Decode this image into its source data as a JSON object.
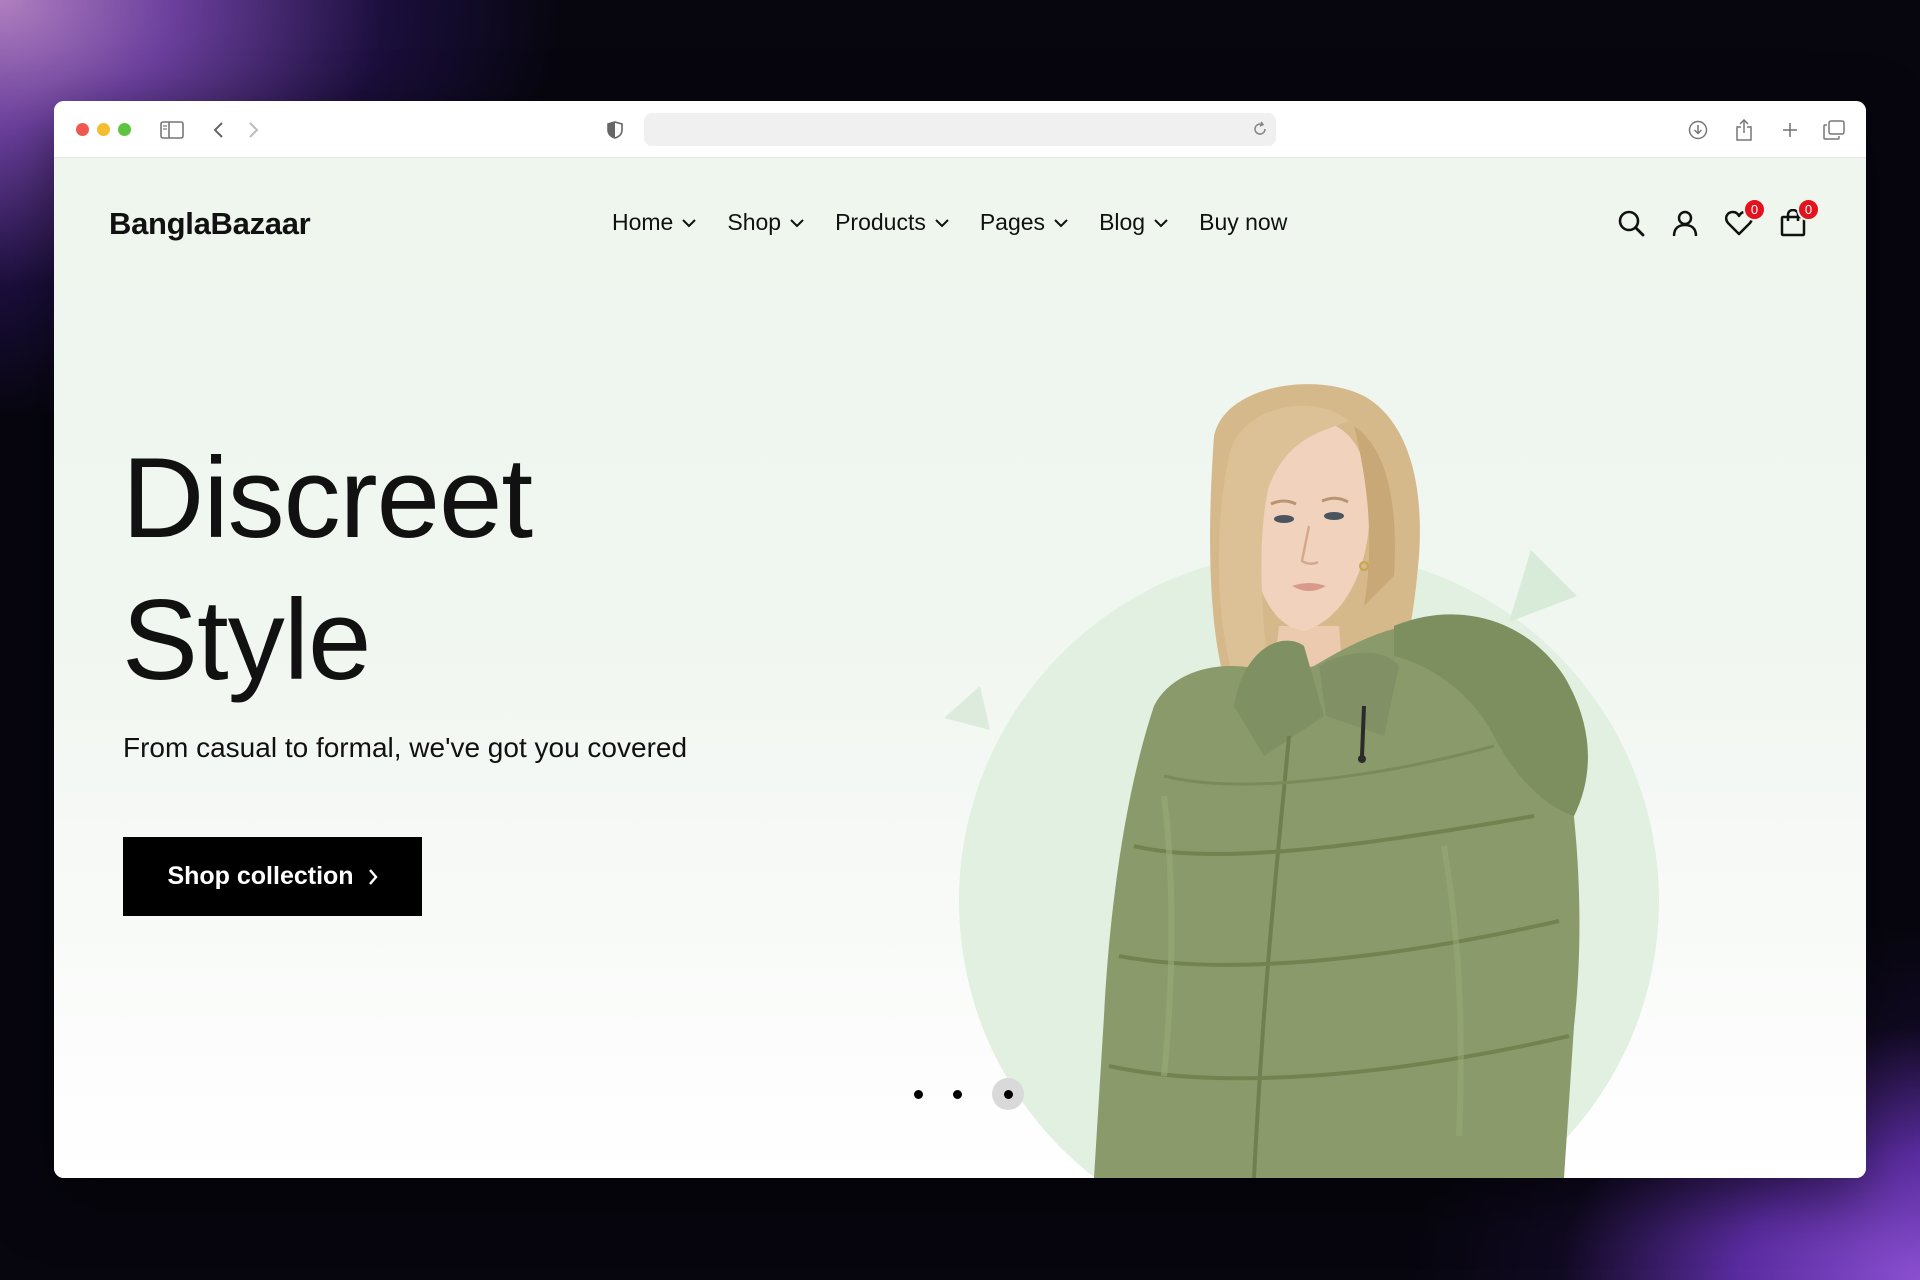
{
  "browser": {
    "icons": [
      "sidebar-icon",
      "back-icon",
      "forward-icon",
      "shield-icon",
      "reload-icon",
      "download-icon",
      "share-icon",
      "new-tab-icon",
      "tabs-overview-icon"
    ],
    "url": ""
  },
  "header": {
    "logo": "BanglaBazaar",
    "nav": [
      {
        "label": "Home",
        "has_dropdown": true
      },
      {
        "label": "Shop",
        "has_dropdown": true
      },
      {
        "label": "Products",
        "has_dropdown": true
      },
      {
        "label": "Pages",
        "has_dropdown": true
      },
      {
        "label": "Blog",
        "has_dropdown": true
      },
      {
        "label": "Buy now",
        "has_dropdown": false
      }
    ],
    "wishlist_count": "0",
    "cart_count": "0"
  },
  "hero": {
    "title_line1": "Discreet",
    "title_line2": "Style",
    "subtitle": "From casual to formal, we've got you covered",
    "cta_label": "Shop collection",
    "slides_total": 3,
    "active_slide": 3
  },
  "colors": {
    "page_bg": "#eef6ee",
    "accent_circle": "#e1f0e1",
    "badge": "#e3121c",
    "jacket": "#8a9a6a",
    "cta_bg": "#000000"
  }
}
